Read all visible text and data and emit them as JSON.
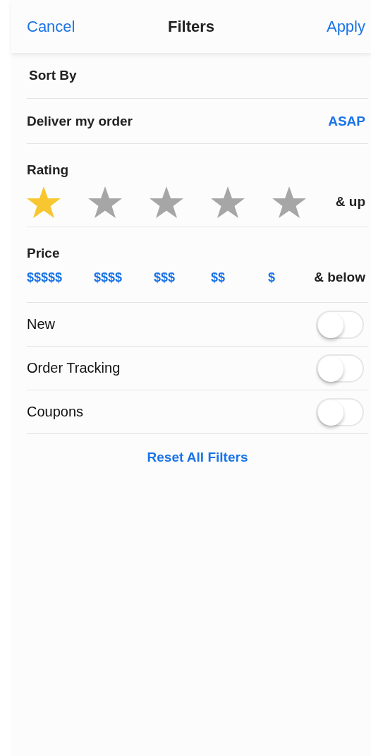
{
  "header": {
    "cancel": "Cancel",
    "title": "Filters",
    "apply": "Apply"
  },
  "sort_by": {
    "label": "Sort By"
  },
  "delivery": {
    "label": "Deliver my order",
    "value": "ASAP"
  },
  "rating": {
    "label": "Rating",
    "stars": 1,
    "suffix": "& up"
  },
  "price": {
    "label": "Price",
    "options": [
      "$$$$$",
      "$$$$",
      "$$$",
      "$$",
      "$"
    ],
    "suffix": "& below"
  },
  "toggles": [
    {
      "label": "New",
      "on": false
    },
    {
      "label": "Order Tracking",
      "on": false
    },
    {
      "label": "Coupons",
      "on": false
    }
  ],
  "reset": "Reset All Filters"
}
